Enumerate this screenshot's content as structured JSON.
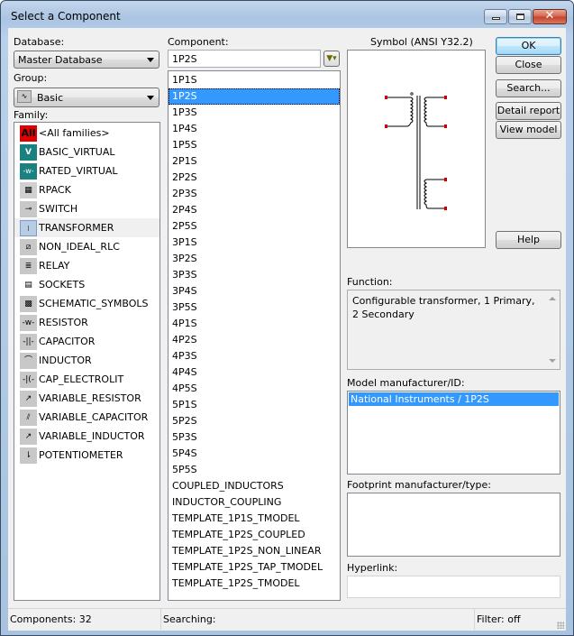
{
  "window": {
    "title": "Select a Component",
    "controls": {
      "minimize": "minimize",
      "maximize": "maximize",
      "close": "✕"
    }
  },
  "database": {
    "label": "Database:",
    "value": "Master Database"
  },
  "group": {
    "label": "Group:",
    "value": "Basic",
    "icon": "basic-group-icon"
  },
  "family": {
    "label": "Family:",
    "items": [
      {
        "label": "<All families>",
        "icon": "all-families-icon",
        "icon_glyph": "All"
      },
      {
        "label": "BASIC_VIRTUAL",
        "icon": "basic-virtual-icon",
        "icon_glyph": "V"
      },
      {
        "label": "RATED_VIRTUAL",
        "icon": "rated-virtual-icon",
        "icon_glyph": "-w-"
      },
      {
        "label": "RPACK",
        "icon": "rpack-icon",
        "icon_glyph": "▦"
      },
      {
        "label": "SWITCH",
        "icon": "switch-icon",
        "icon_glyph": "⊸"
      },
      {
        "label": "TRANSFORMER",
        "icon": "transformer-icon",
        "icon_glyph": "⧙"
      },
      {
        "label": "NON_IDEAL_RLC",
        "icon": "non-ideal-rlc-icon",
        "icon_glyph": "⧄"
      },
      {
        "label": "RELAY",
        "icon": "relay-icon",
        "icon_glyph": "≣"
      },
      {
        "label": "SOCKETS",
        "icon": "sockets-icon",
        "icon_glyph": "▤"
      },
      {
        "label": "SCHEMATIC_SYMBOLS",
        "icon": "schematic-symbols-icon",
        "icon_glyph": "▩"
      },
      {
        "label": "RESISTOR",
        "icon": "resistor-icon",
        "icon_glyph": "-w-"
      },
      {
        "label": "CAPACITOR",
        "icon": "capacitor-icon",
        "icon_glyph": "-||-"
      },
      {
        "label": "INDUCTOR",
        "icon": "inductor-icon",
        "icon_glyph": "⌒"
      },
      {
        "label": "CAP_ELECTROLIT",
        "icon": "cap-electrolit-icon",
        "icon_glyph": "-|(-"
      },
      {
        "label": "VARIABLE_RESISTOR",
        "icon": "variable-resistor-icon",
        "icon_glyph": "↗"
      },
      {
        "label": "VARIABLE_CAPACITOR",
        "icon": "variable-capacitor-icon",
        "icon_glyph": "⫽"
      },
      {
        "label": "VARIABLE_INDUCTOR",
        "icon": "variable-inductor-icon",
        "icon_glyph": "↗"
      },
      {
        "label": "POTENTIOMETER",
        "icon": "potentiometer-icon",
        "icon_glyph": "⇂"
      }
    ],
    "hovered_index": 5
  },
  "component": {
    "label": "Component:",
    "search_value": "1P2S",
    "filter_icon": "filter-icon",
    "selected_index": 1,
    "items": [
      "1P1S",
      "1P2S",
      "1P3S",
      "1P4S",
      "1P5S",
      "2P1S",
      "2P2S",
      "2P3S",
      "2P4S",
      "2P5S",
      "3P1S",
      "3P2S",
      "3P3S",
      "3P4S",
      "3P5S",
      "4P1S",
      "4P2S",
      "4P3S",
      "4P4S",
      "4P5S",
      "5P1S",
      "5P2S",
      "5P3S",
      "5P4S",
      "5P5S",
      "COUPLED_INDUCTORS",
      "INDUCTOR_COUPLING",
      "TEMPLATE_1P1S_TMODEL",
      "TEMPLATE_1P2S_COUPLED",
      "TEMPLATE_1P2S_NON_LINEAR",
      "TEMPLATE_1P2S_TAP_TMODEL",
      "TEMPLATE_1P2S_TMODEL"
    ]
  },
  "symbol": {
    "label": "Symbol (ANSI Y32.2)"
  },
  "buttons": {
    "ok": "OK",
    "close": "Close",
    "search": "Search...",
    "detail_report": "Detail report",
    "view_model": "View model",
    "help": "Help"
  },
  "function": {
    "label": "Function:",
    "text": "Configurable transformer, 1 Primary, 2 Secondary"
  },
  "model": {
    "label": "Model manufacturer/ID:",
    "selected": "National Instruments / 1P2S"
  },
  "footprint": {
    "label": "Footprint manufacturer/type:",
    "value": ""
  },
  "hyperlink": {
    "label": "Hyperlink:",
    "value": ""
  },
  "status": {
    "components": "Components: 32",
    "searching": "Searching:",
    "filter": "Filter: off"
  },
  "colors": {
    "selection": "#3399ff",
    "pin_marker": "#cc0000",
    "all_icon_bg": "#e00000",
    "virtual_icon_bg": "#1a8080"
  }
}
